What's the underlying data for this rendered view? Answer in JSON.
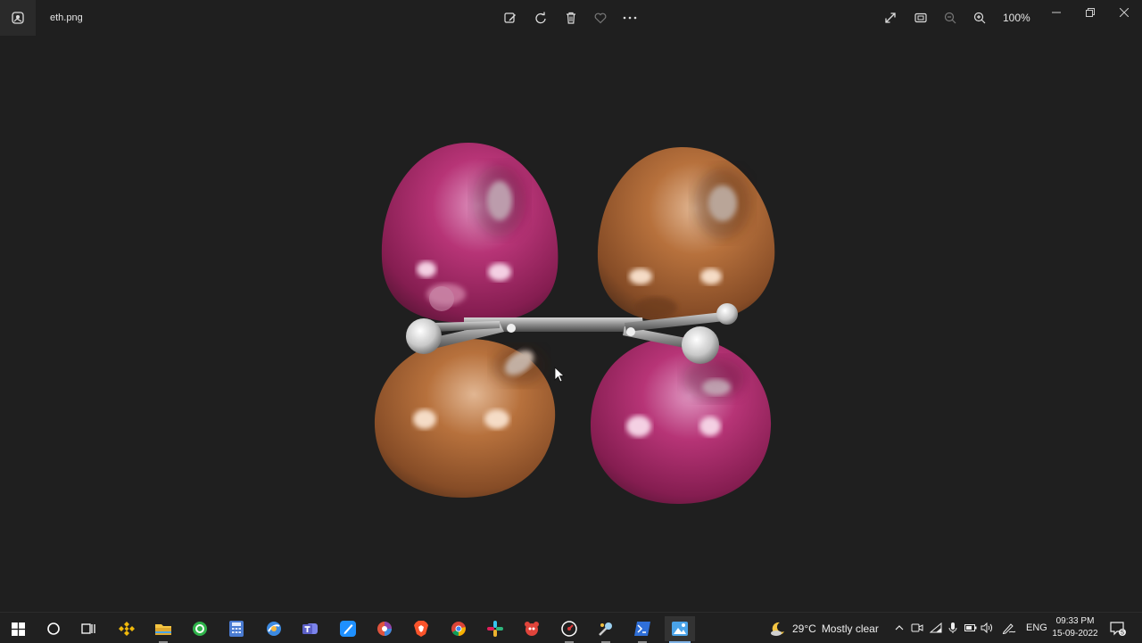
{
  "window": {
    "title": "eth.png",
    "zoom_level": "100%",
    "toolbar": [
      {
        "name": "edit-image-icon"
      },
      {
        "name": "rotate-icon"
      },
      {
        "name": "delete-icon"
      },
      {
        "name": "favorite-heart-icon"
      },
      {
        "name": "more-options-icon"
      }
    ],
    "right_tools": [
      {
        "name": "fullscreen-expand-icon"
      },
      {
        "name": "fit-to-window-icon"
      },
      {
        "name": "zoom-out-icon"
      },
      {
        "name": "zoom-in-icon"
      }
    ]
  },
  "image": {
    "description_icons": "ethylene-pi-orbital-render",
    "colors": {
      "magenta_lobe": "#b8246e",
      "orange_lobe": "#b86a36",
      "bond": "#9a9a9a",
      "background": "#1f1f1f"
    }
  },
  "taskbar": {
    "apps": [
      {
        "name": "start-windows-icon",
        "color": "#ffffff"
      },
      {
        "name": "search-circle-icon",
        "color": "#ffffff"
      },
      {
        "name": "task-view-icon",
        "color": "#ffffff"
      },
      {
        "name": "binance-app-icon",
        "color": "#f0b90b"
      },
      {
        "name": "file-explorer-icon",
        "color": "#f4c542"
      },
      {
        "name": "green-app-icon",
        "color": "#2fb34a"
      },
      {
        "name": "calculator-icon",
        "color": "#4a7bd1"
      },
      {
        "name": "browser-app-icon",
        "color": "#3d8ae0"
      },
      {
        "name": "teams-icon",
        "color": "#5b5fc7"
      },
      {
        "name": "notes-app-icon",
        "color": "#1e90ff"
      },
      {
        "name": "colorful-app-icon",
        "color": "#e0533d"
      },
      {
        "name": "brave-browser-icon",
        "color": "#fb542b"
      },
      {
        "name": "chrome-icon",
        "color": "#34a853"
      },
      {
        "name": "slack-like-icon",
        "color": "#36c5f0"
      },
      {
        "name": "red-app-icon",
        "color": "#e0443b"
      },
      {
        "name": "dial-app-icon",
        "color": "#d83a3a"
      },
      {
        "name": "tool-app-icon",
        "color": "#cccccc"
      },
      {
        "name": "powershell-icon",
        "color": "#2f6fd8"
      },
      {
        "name": "photos-app-icon",
        "color": "#4aa3e8"
      }
    ],
    "weather": {
      "temp": "29°C",
      "condition": "Mostly clear"
    },
    "language": "ENG",
    "clock": {
      "time": "09:33 PM",
      "date": "15-09-2022"
    },
    "notification_count": "5"
  }
}
